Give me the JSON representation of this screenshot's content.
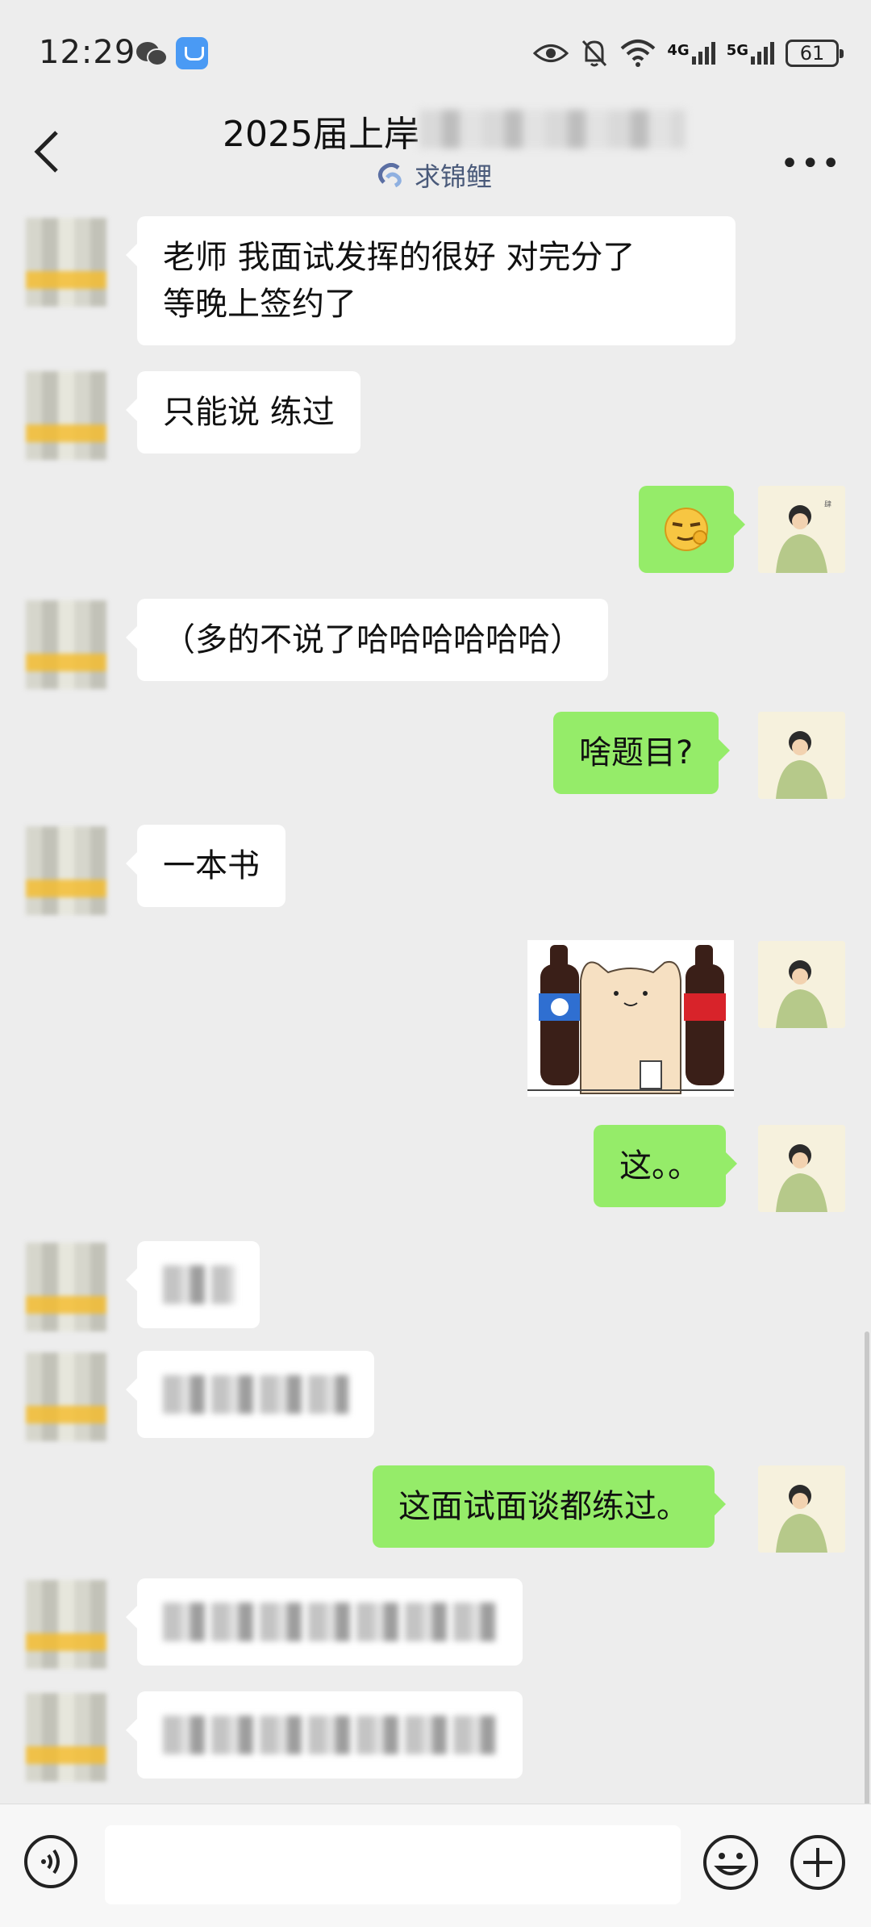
{
  "status_bar": {
    "time": "12:29",
    "network_1": "4G",
    "network_2": "5G",
    "battery": "61"
  },
  "header": {
    "title": "2025届上岸",
    "subtitle": "求锦鲤"
  },
  "messages": [
    {
      "side": "left",
      "lines": [
        "老师 我面试发挥的很好 对完分了",
        "等晚上签约了"
      ]
    },
    {
      "side": "left",
      "text": "只能说 练过"
    },
    {
      "side": "right",
      "type": "emoji",
      "emoji": "smirk-emoji"
    },
    {
      "side": "left",
      "text": "（多的不说了哈哈哈哈哈哈）"
    },
    {
      "side": "right",
      "text": "啥题目?"
    },
    {
      "side": "left",
      "text": "一本书"
    },
    {
      "side": "right",
      "type": "sticker",
      "sticker": "cat-with-cola-bottles-sticker"
    },
    {
      "side": "right",
      "text": "这。。"
    },
    {
      "side": "left",
      "blurred": true
    },
    {
      "side": "left",
      "blurred": true
    },
    {
      "side": "right",
      "text": "这面试面谈都练过。"
    },
    {
      "side": "left",
      "blurred": true
    },
    {
      "side": "left",
      "blurred": true
    }
  ],
  "input_bar": {
    "placeholder": "",
    "icons": [
      "voice-icon",
      "emoji-icon",
      "plus-icon"
    ]
  },
  "colors": {
    "bubble_self": "#95ec69",
    "bubble_other": "#ffffff",
    "background": "#ededed"
  }
}
